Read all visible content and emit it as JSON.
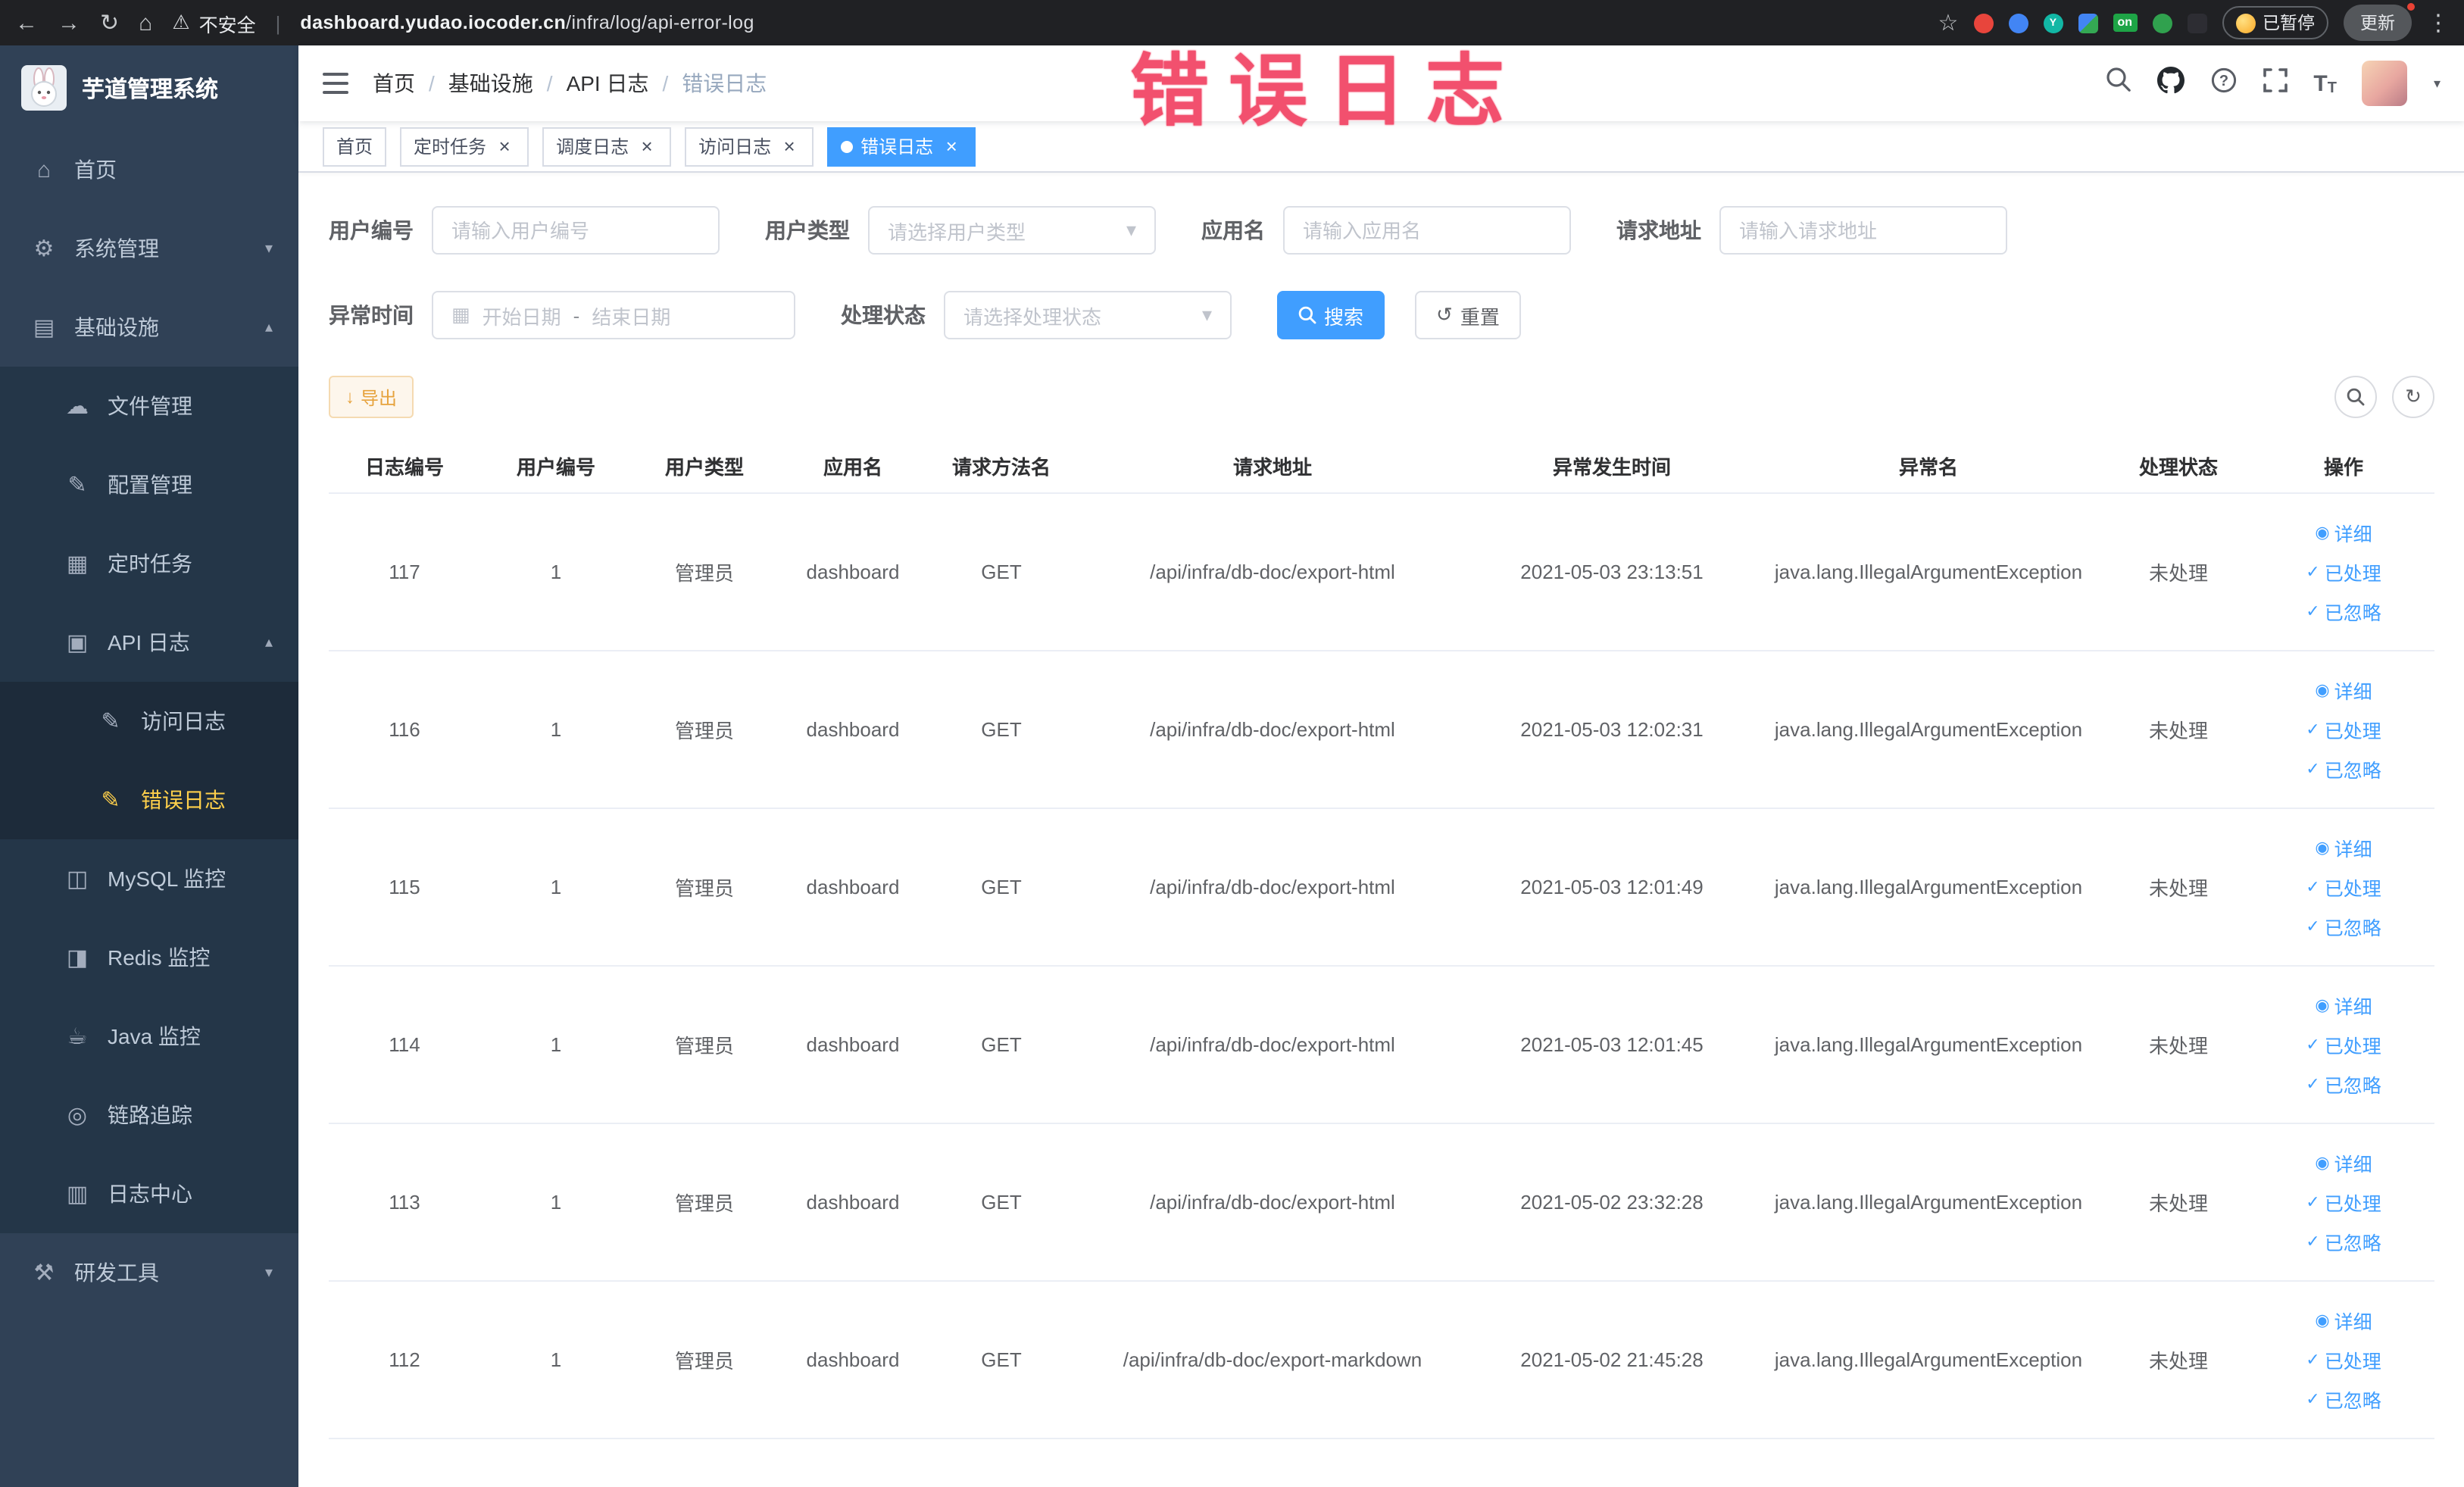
{
  "browser": {
    "security_label": "不安全",
    "url_domain": "dashboard.yudao.iocoder.cn",
    "url_path": "/infra/log/api-error-log",
    "on_badge": "on",
    "paused_label": "已暂停",
    "update_label": "更新"
  },
  "sidebar": {
    "logo_title": "芋道管理系统",
    "items": [
      {
        "key": "home",
        "label": "首页",
        "icon": "home",
        "level": 0
      },
      {
        "key": "system-mgmt",
        "label": "系统管理",
        "icon": "gear",
        "level": 0,
        "arrow": "down"
      },
      {
        "key": "infrastructure",
        "label": "基础设施",
        "icon": "monitor",
        "level": 0,
        "arrow": "up"
      },
      {
        "key": "file-mgmt",
        "label": "文件管理",
        "icon": "cloud",
        "level": 1
      },
      {
        "key": "config-mgmt",
        "label": "配置管理",
        "icon": "edit",
        "level": 1
      },
      {
        "key": "scheduled-task",
        "label": "定时任务",
        "icon": "grid",
        "level": 1
      },
      {
        "key": "api-log",
        "label": "API 日志",
        "icon": "doc",
        "level": 1,
        "arrow": "up"
      },
      {
        "key": "access-log",
        "label": "访问日志",
        "icon": "pen",
        "level": 2
      },
      {
        "key": "error-log",
        "label": "错误日志",
        "icon": "pen",
        "level": 2,
        "active": true
      },
      {
        "key": "mysql-monitor",
        "label": "MySQL 监控",
        "icon": "db",
        "level": 1
      },
      {
        "key": "redis-monitor",
        "label": "Redis 监控",
        "icon": "db2",
        "level": 1
      },
      {
        "key": "java-monitor",
        "label": "Java 监控",
        "icon": "java",
        "level": 1
      },
      {
        "key": "trace",
        "label": "链路追踪",
        "icon": "eye",
        "level": 1
      },
      {
        "key": "log-center",
        "label": "日志中心",
        "icon": "log",
        "level": 1
      },
      {
        "key": "dev-tools",
        "label": "研发工具",
        "icon": "tools",
        "level": 0,
        "arrow": "down"
      }
    ]
  },
  "navbar": {
    "breadcrumb": [
      "首页",
      "基础设施",
      "API 日志",
      "错误日志"
    ],
    "separator": "/"
  },
  "annotation": "错误日志",
  "tabs": [
    {
      "key": "home",
      "label": "首页",
      "closable": false,
      "active": false
    },
    {
      "key": "scheduled-task",
      "label": "定时任务",
      "closable": true,
      "active": false
    },
    {
      "key": "schedule-log",
      "label": "调度日志",
      "closable": true,
      "active": false
    },
    {
      "key": "access-log",
      "label": "访问日志",
      "closable": true,
      "active": false
    },
    {
      "key": "error-log",
      "label": "错误日志",
      "closable": true,
      "active": true
    }
  ],
  "filters": {
    "user_id": {
      "label": "用户编号",
      "placeholder": "请输入用户编号"
    },
    "user_type": {
      "label": "用户类型",
      "placeholder": "请选择用户类型"
    },
    "app_name": {
      "label": "应用名",
      "placeholder": "请输入应用名"
    },
    "request_url": {
      "label": "请求地址",
      "placeholder": "请输入请求地址"
    },
    "exception_time": {
      "label": "异常时间",
      "start": "开始日期",
      "separator": "-",
      "end": "结束日期"
    },
    "process_status": {
      "label": "处理状态",
      "placeholder": "请选择处理状态"
    },
    "search_label": "搜索",
    "reset_label": "重置"
  },
  "toolbar": {
    "export_label": "导出"
  },
  "table": {
    "headers": [
      "日志编号",
      "用户编号",
      "用户类型",
      "应用名",
      "请求方法名",
      "请求地址",
      "异常发生时间",
      "异常名",
      "处理状态",
      "操作"
    ],
    "action_labels": {
      "detail": "详细",
      "processed": "已处理",
      "ignored": "已忽略"
    },
    "rows": [
      {
        "id": "117",
        "user_id": "1",
        "user_type": "管理员",
        "app": "dashboard",
        "method": "GET",
        "url": "/api/infra/db-doc/export-html",
        "time": "2021-05-03 23:13:51",
        "exception": "java.lang.IllegalArgumentException",
        "status": "未处理"
      },
      {
        "id": "116",
        "user_id": "1",
        "user_type": "管理员",
        "app": "dashboard",
        "method": "GET",
        "url": "/api/infra/db-doc/export-html",
        "time": "2021-05-03 12:02:31",
        "exception": "java.lang.IllegalArgumentException",
        "status": "未处理"
      },
      {
        "id": "115",
        "user_id": "1",
        "user_type": "管理员",
        "app": "dashboard",
        "method": "GET",
        "url": "/api/infra/db-doc/export-html",
        "time": "2021-05-03 12:01:49",
        "exception": "java.lang.IllegalArgumentException",
        "status": "未处理"
      },
      {
        "id": "114",
        "user_id": "1",
        "user_type": "管理员",
        "app": "dashboard",
        "method": "GET",
        "url": "/api/infra/db-doc/export-html",
        "time": "2021-05-03 12:01:45",
        "exception": "java.lang.IllegalArgumentException",
        "status": "未处理"
      },
      {
        "id": "113",
        "user_id": "1",
        "user_type": "管理员",
        "app": "dashboard",
        "method": "GET",
        "url": "/api/infra/db-doc/export-html",
        "time": "2021-05-02 23:32:28",
        "exception": "java.lang.IllegalArgumentException",
        "status": "未处理"
      },
      {
        "id": "112",
        "user_id": "1",
        "user_type": "管理员",
        "app": "dashboard",
        "method": "GET",
        "url": "/api/infra/db-doc/export-markdown",
        "time": "2021-05-02 21:45:28",
        "exception": "java.lang.IllegalArgumentException",
        "status": "未处理"
      }
    ]
  },
  "colors": {
    "primary": "#409eff",
    "warning": "#e6a23c",
    "sidebar_bg": "#304156",
    "menu_active": "#ffd04b",
    "annotation": "#f2506e"
  }
}
